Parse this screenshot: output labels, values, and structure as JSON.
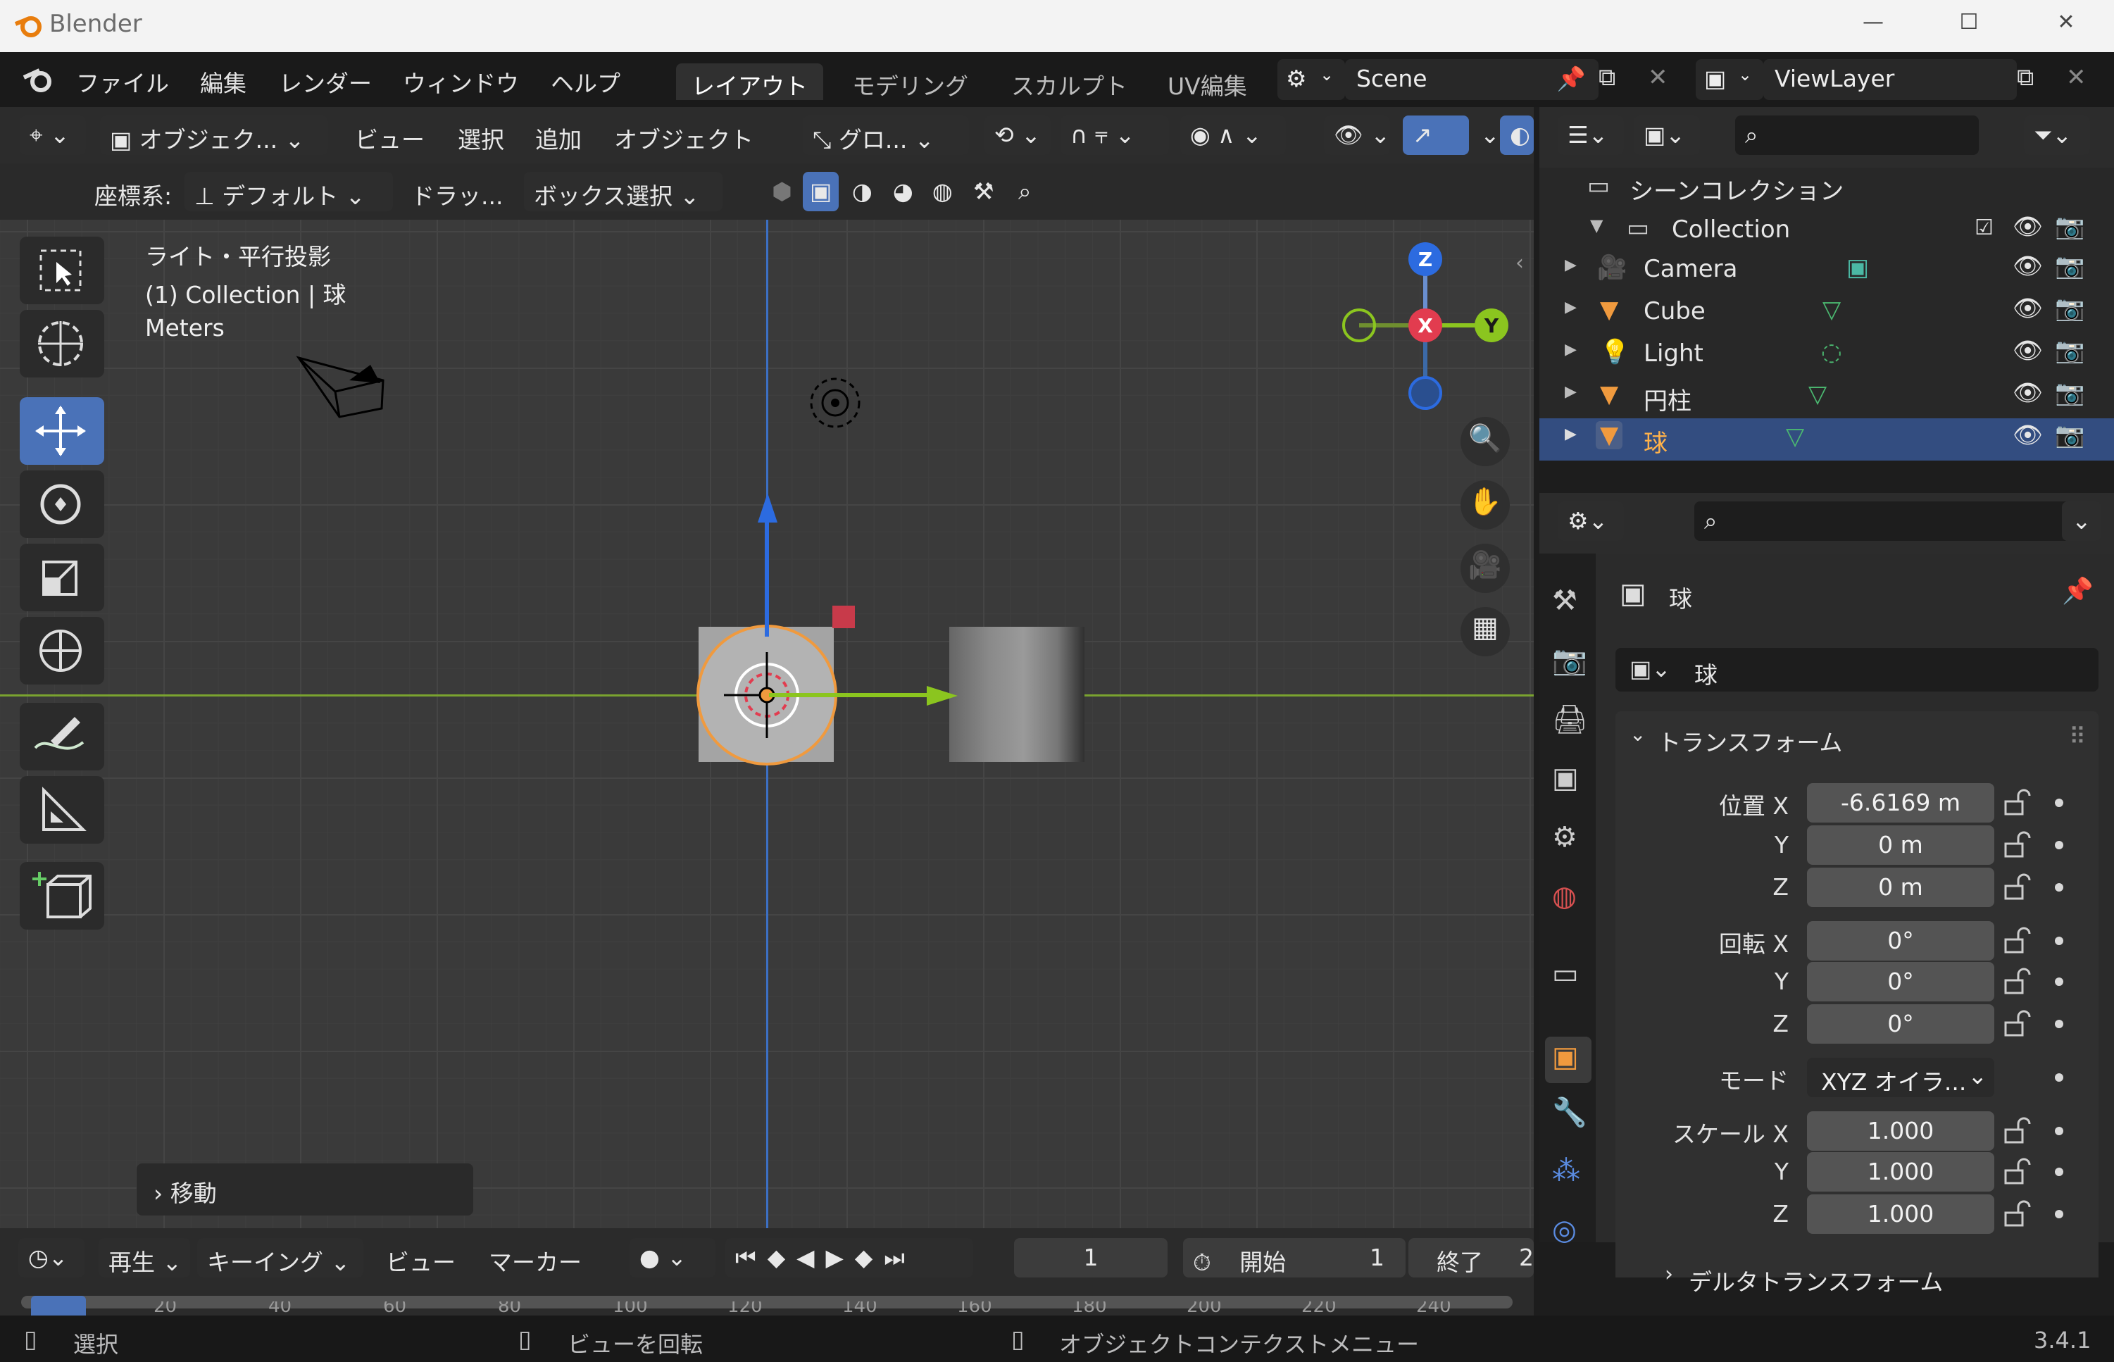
{
  "window": {
    "title": "Blender",
    "minimize": "—",
    "maximize": "☐",
    "close": "✕"
  },
  "topbar": {
    "menus": [
      "ファイル",
      "編集",
      "レンダー",
      "ウィンドウ",
      "ヘルプ"
    ],
    "workspaces": [
      "レイアウト",
      "モデリング",
      "スカルプト",
      "UV編集"
    ],
    "active_workspace": "レイアウト",
    "scene": "Scene",
    "view_layer": "ViewLayer"
  },
  "viewport": {
    "header": {
      "mode": "オブジェク...",
      "view": "ビュー",
      "select": "選択",
      "add": "追加",
      "object": "オブジェクト",
      "transform_orientation": "グロ..."
    },
    "toolsettings": {
      "coord_label": "座標系:",
      "coord_value": "デフォルト",
      "drag_label": "ドラッ...",
      "drag_value": "ボックス選択"
    },
    "overlay_text": [
      "ライト・平行投影",
      "(1) Collection | 球",
      "Meters"
    ],
    "gizmo": {
      "x": "X",
      "y": "Y",
      "z": "Z"
    },
    "last_op": "移動"
  },
  "outliner": {
    "scene_collection": "シーンコレクション",
    "collection": "Collection",
    "items": [
      {
        "name": "Camera",
        "icon": "camera-icon"
      },
      {
        "name": "Cube",
        "icon": "mesh-icon"
      },
      {
        "name": "Light",
        "icon": "light-icon"
      },
      {
        "name": "円柱",
        "icon": "mesh-icon"
      },
      {
        "name": "球",
        "icon": "mesh-icon",
        "selected": true
      }
    ]
  },
  "properties": {
    "object_name": "球",
    "object_field": "球",
    "transform_title": "トランスフォーム",
    "location": {
      "label": "位置",
      "x": "-6.6169 m",
      "y": "0 m",
      "z": "0 m"
    },
    "rotation": {
      "label": "回転",
      "x": "0°",
      "y": "0°",
      "z": "0°"
    },
    "mode_label": "モード",
    "mode_value": "XYZ オイラ...",
    "scale": {
      "label": "スケール",
      "x": "1.000",
      "y": "1.000",
      "z": "1.000"
    },
    "axis": {
      "x": "X",
      "y": "Y",
      "z": "Z"
    },
    "delta_title": "デルタトランスフォーム"
  },
  "timeline": {
    "playback": "再生",
    "keying": "キーイング",
    "view": "ビュー",
    "marker": "マーカー",
    "current_frame": "1",
    "start_label": "開始",
    "start": "1",
    "end_label": "終了",
    "end": "2",
    "ruler": [
      "20",
      "40",
      "60",
      "80",
      "100",
      "120",
      "140",
      "160",
      "180",
      "200",
      "220",
      "240"
    ]
  },
  "status": {
    "select": "選択",
    "rotate": "ビューを回転",
    "context": "オブジェクトコンテクストメニュー",
    "version": "3.4.1"
  },
  "colors": {
    "accent_blue": "#4a72b8",
    "selection_orange": "#f09a3e",
    "axis_x": "#e23c4f",
    "axis_y": "#8bc51f",
    "axis_z": "#2c6be0"
  }
}
